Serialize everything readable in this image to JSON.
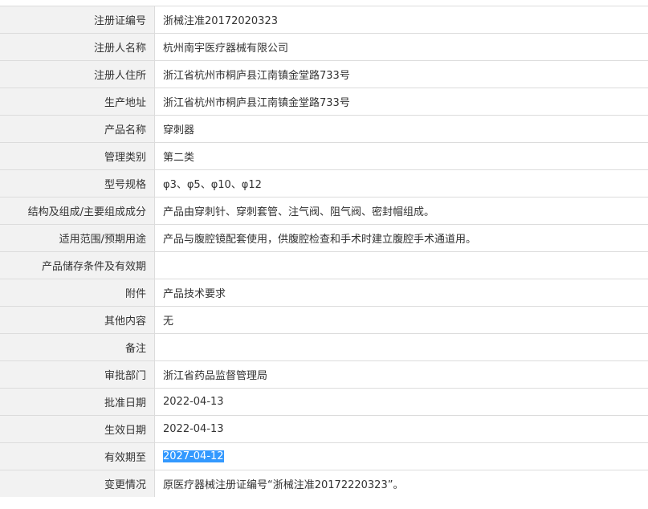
{
  "rows": [
    {
      "label": "注册证编号",
      "value": "浙械注准20172020323"
    },
    {
      "label": "注册人名称",
      "value": "杭州南宇医疗器械有限公司"
    },
    {
      "label": "注册人住所",
      "value": "浙江省杭州市桐庐县江南镇金堂路733号"
    },
    {
      "label": "生产地址",
      "value": "浙江省杭州市桐庐县江南镇金堂路733号"
    },
    {
      "label": "产品名称",
      "value": "穿刺器"
    },
    {
      "label": "管理类别",
      "value": "第二类"
    },
    {
      "label": "型号规格",
      "value": "φ3、φ5、φ10、φ12"
    },
    {
      "label": "结构及组成/主要组成成分",
      "value": "产品由穿刺针、穿刺套管、注气阀、阻气阀、密封帽组成。"
    },
    {
      "label": "适用范围/预期用途",
      "value": "产品与腹腔镜配套使用，供腹腔检查和手术时建立腹腔手术通道用。"
    },
    {
      "label": "产品储存条件及有效期",
      "value": ""
    },
    {
      "label": "附件",
      "value": "产品技术要求"
    },
    {
      "label": "其他内容",
      "value": "无"
    },
    {
      "label": "备注",
      "value": ""
    },
    {
      "label": "审批部门",
      "value": "浙江省药品监督管理局"
    },
    {
      "label": "批准日期",
      "value": "2022-04-13"
    },
    {
      "label": "生效日期",
      "value": "2022-04-13"
    },
    {
      "label": "有效期至",
      "value": "2027-04-12"
    },
    {
      "label": "变更情况",
      "value": "原医疗器械注册证编号“浙械注准20172220323”。"
    }
  ],
  "selected_row_label": "有效期至"
}
